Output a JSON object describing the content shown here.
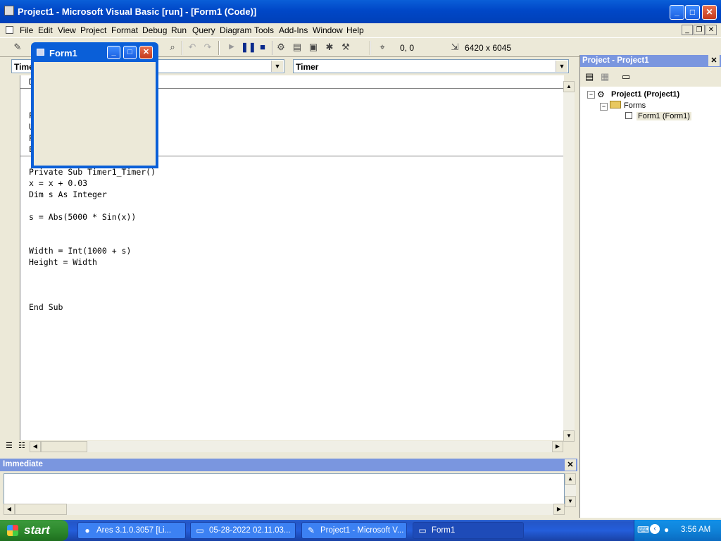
{
  "app": {
    "title": "Project1 - Microsoft Visual Basic [run] - [Form1 (Code)]"
  },
  "menu": [
    "File",
    "Edit",
    "View",
    "Project",
    "Format",
    "Debug",
    "Run",
    "Query",
    "Diagram",
    "Tools",
    "Add-Ins",
    "Window",
    "Help"
  ],
  "toolbar": {
    "position": "0, 0",
    "size": "6420 x 6045"
  },
  "code_window": {
    "object_combo": "Timer",
    "procedure_combo": "Timer",
    "lines": [
      "Private Sub Timer1_Timer()",
      "x = x + 0.03",
      "Dim s As Integer",
      "",
      "s = Abs(5000 * Sin(x))",
      "",
      "",
      "Width = Int(1000 + s)",
      "Height = Width",
      "",
      "",
      "",
      "End Sub"
    ]
  },
  "form1": {
    "title": "Form1"
  },
  "project_explorer": {
    "title": "Project - Project1",
    "tree": {
      "project": "Project1 (Project1)",
      "folder": "Forms",
      "item": "Form1 (Form1)"
    }
  },
  "immediate": {
    "title": "Immediate"
  },
  "taskbar": {
    "start_label": "start",
    "tasks": [
      {
        "label": "Ares 3.1.0.3057   [Li..."
      },
      {
        "label": "05-28-2022 02.11.03..."
      },
      {
        "label": "Project1 - Microsoft V..."
      },
      {
        "label": "Form1"
      }
    ],
    "clock": "3:56 AM"
  }
}
